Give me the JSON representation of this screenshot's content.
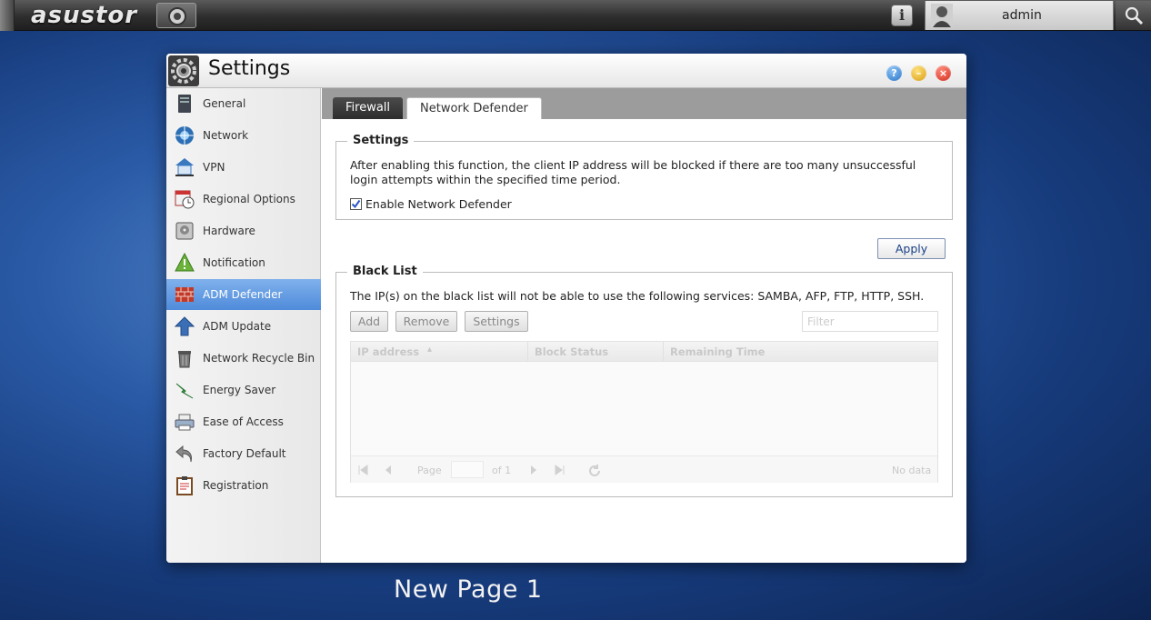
{
  "topbar": {
    "brand": "asustor",
    "user_name": "admin"
  },
  "window": {
    "title": "Settings"
  },
  "sidebar": {
    "active_color": "#5a94df",
    "items": [
      {
        "label": "General",
        "icon": "server-icon"
      },
      {
        "label": "Network",
        "icon": "globe-icon"
      },
      {
        "label": "VPN",
        "icon": "vpn-icon"
      },
      {
        "label": "Regional Options",
        "icon": "calendar-clock-icon"
      },
      {
        "label": "Hardware",
        "icon": "hard-drive-icon"
      },
      {
        "label": "Notification",
        "icon": "warning-icon"
      },
      {
        "label": "ADM Defender",
        "icon": "brick-wall-icon",
        "active": true
      },
      {
        "label": "ADM Update",
        "icon": "arrow-up-icon"
      },
      {
        "label": "Network Recycle Bin",
        "icon": "trash-bin-icon"
      },
      {
        "label": "Energy Saver",
        "icon": "energy-icon"
      },
      {
        "label": "Ease of Access",
        "icon": "printer-icon"
      },
      {
        "label": "Factory Default",
        "icon": "undo-icon"
      },
      {
        "label": "Registration",
        "icon": "clipboard-icon"
      }
    ]
  },
  "tabs": {
    "firewall": "Firewall",
    "network_defender": "Network Defender"
  },
  "settings_section": {
    "legend": "Settings",
    "description": "After enabling this function, the client IP address will be blocked if there are too many unsuccessful login attempts within the specified time period.",
    "enable_label": "Enable Network Defender",
    "enable_checked": true
  },
  "apply_label": "Apply",
  "blacklist": {
    "legend": "Black List",
    "description": "The IP(s) on the black list will not be able to use the following services: SAMBA, AFP, FTP, HTTP, SSH.",
    "add_label": "Add",
    "remove_label": "Remove",
    "settings_label": "Settings",
    "filter_placeholder": "Filter",
    "columns": [
      "IP address",
      "Block Status",
      "Remaining Time"
    ],
    "pager": {
      "page_label": "Page",
      "of_label": "of 1",
      "status": "No data"
    }
  },
  "footer_label": "New Page 1"
}
